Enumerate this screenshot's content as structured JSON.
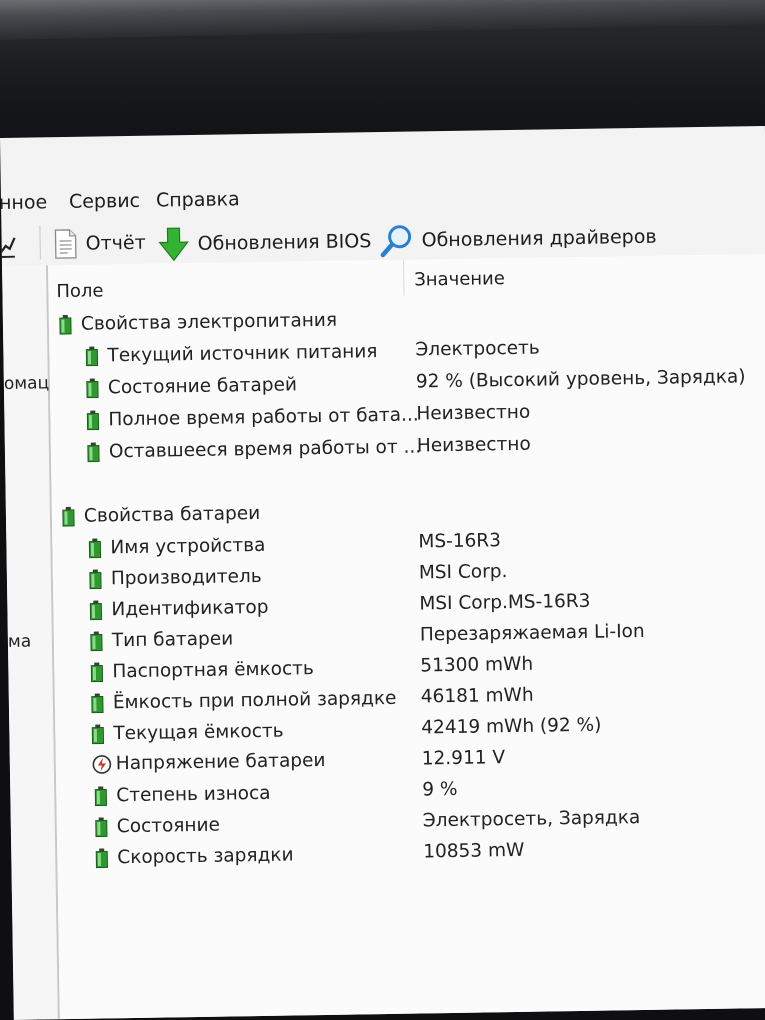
{
  "menu": {
    "items": [
      "нное",
      "Сервис",
      "Справка"
    ]
  },
  "toolbar": {
    "report_label": "Отчёт",
    "bios_label": "Обновления BIOS",
    "drivers_label": "Обновления драйверов"
  },
  "left_pane": {
    "items": [
      "омац",
      "ма"
    ]
  },
  "table": {
    "col_field": "Поле",
    "col_value": "Значение",
    "power_group": {
      "title": "Свойства электропитания",
      "rows": [
        {
          "field": "Текущий источник питания",
          "value": "Электросеть",
          "icon": "battery-icon"
        },
        {
          "field": "Состояние батарей",
          "value": "92 % (Высокий уровень, Зарядка)",
          "icon": "battery-icon"
        },
        {
          "field": "Полное время работы от бата...",
          "value": "Неизвестно",
          "icon": "battery-icon"
        },
        {
          "field": "Оставшееся время работы от ...",
          "value": "Неизвестно",
          "icon": "battery-icon"
        }
      ]
    },
    "battery_group": {
      "title": "Свойства батареи",
      "rows": [
        {
          "field": "Имя устройства",
          "value": "MS-16R3",
          "icon": "battery-icon"
        },
        {
          "field": "Производитель",
          "value": "MSI Corp.",
          "icon": "battery-icon"
        },
        {
          "field": "Идентификатор",
          "value": "MSI Corp.MS-16R3",
          "icon": "battery-icon"
        },
        {
          "field": "Тип батареи",
          "value": "Перезаряжаемая Li-Ion",
          "icon": "battery-icon"
        },
        {
          "field": "Паспортная ёмкость",
          "value": "51300 mWh",
          "icon": "battery-icon"
        },
        {
          "field": "Ёмкость при полной зарядке",
          "value": "46181 mWh",
          "icon": "battery-icon"
        },
        {
          "field": "Текущая ёмкость",
          "value": "42419 mWh  (92 %)",
          "icon": "battery-icon"
        },
        {
          "field": "Напряжение батареи",
          "value": "12.911 V",
          "icon": "voltage-icon"
        },
        {
          "field": "Степень износа",
          "value": "9 %",
          "icon": "battery-icon"
        },
        {
          "field": "Состояние",
          "value": "Электросеть, Зарядка",
          "icon": "battery-icon"
        },
        {
          "field": "Скорость зарядки",
          "value": "10853 mW",
          "icon": "battery-icon"
        }
      ]
    }
  },
  "colors": {
    "battery_green": "#2e9a2e",
    "arrow_green": "#34b233",
    "magnifier_blue": "#2a7fd0",
    "voltage_red": "#c0392b"
  }
}
